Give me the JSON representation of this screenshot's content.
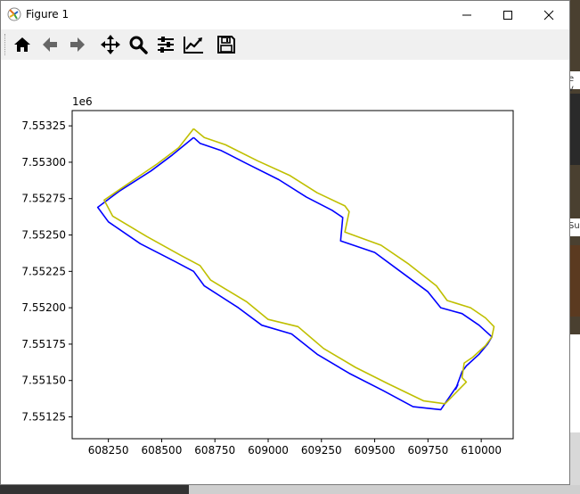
{
  "window": {
    "title": "Figure 1",
    "minimize_glyph": "—",
    "maximize_glyph": "☐",
    "close_glyph": "✕"
  },
  "toolbar": {
    "buttons": [
      {
        "icon": "home-icon"
      },
      {
        "icon": "back-arrow-icon"
      },
      {
        "icon": "forward-arrow-icon"
      },
      {
        "icon": "pan-move-icon"
      },
      {
        "icon": "zoom-magnifier-icon"
      },
      {
        "icon": "configure-subplots-icon"
      },
      {
        "icon": "edit-axis-icon"
      },
      {
        "icon": "save-floppy-icon"
      }
    ]
  },
  "background": {
    "right_text_1": "e v",
    "right_text_2": "Sup"
  },
  "chart_data": {
    "type": "line",
    "offset_label": "1e6",
    "xlim": [
      608080,
      610150
    ],
    "ylim": [
      7551100,
      7553355
    ],
    "xticks": [
      608250,
      608500,
      608750,
      609000,
      609250,
      609500,
      609750,
      610000
    ],
    "yticks": [
      7551250,
      7551500,
      7551750,
      7552000,
      7552250,
      7552500,
      7552750,
      7553000,
      7553250
    ],
    "ytick_labels": [
      "7.55125",
      "7.55150",
      "7.55175",
      "7.55200",
      "7.55225",
      "7.55250",
      "7.55275",
      "7.55300",
      "7.55325"
    ],
    "grid": false,
    "series": [
      {
        "color": "#0000ff",
        "points": [
          [
            608650,
            7553170
          ],
          [
            608680,
            7553130
          ],
          [
            608780,
            7553080
          ],
          [
            608900,
            7552990
          ],
          [
            609050,
            7552880
          ],
          [
            609180,
            7552760
          ],
          [
            609300,
            7552670
          ],
          [
            609350,
            7552620
          ],
          [
            609340,
            7552460
          ],
          [
            609500,
            7552380
          ],
          [
            609620,
            7552250
          ],
          [
            609750,
            7552110
          ],
          [
            609810,
            7552000
          ],
          [
            609910,
            7551960
          ],
          [
            609990,
            7551880
          ],
          [
            610050,
            7551800
          ],
          [
            610030,
            7551750
          ],
          [
            609990,
            7551680
          ],
          [
            609930,
            7551600
          ],
          [
            609910,
            7551560
          ],
          [
            609880,
            7551440
          ],
          [
            609890,
            7551470
          ],
          [
            609810,
            7551300
          ],
          [
            609680,
            7551320
          ],
          [
            609540,
            7551430
          ],
          [
            609380,
            7551550
          ],
          [
            609230,
            7551680
          ],
          [
            609110,
            7551820
          ],
          [
            608970,
            7551880
          ],
          [
            608860,
            7552000
          ],
          [
            608700,
            7552150
          ],
          [
            608650,
            7552250
          ],
          [
            608560,
            7552320
          ],
          [
            608400,
            7552440
          ],
          [
            608250,
            7552590
          ],
          [
            608200,
            7552690
          ],
          [
            608300,
            7552800
          ],
          [
            608450,
            7552940
          ],
          [
            608550,
            7553050
          ],
          [
            608650,
            7553170
          ]
        ]
      },
      {
        "color": "#bfbf00",
        "points": [
          [
            608650,
            7553230
          ],
          [
            608700,
            7553170
          ],
          [
            608800,
            7553120
          ],
          [
            608950,
            7553010
          ],
          [
            609100,
            7552910
          ],
          [
            609230,
            7552790
          ],
          [
            609360,
            7552700
          ],
          [
            609380,
            7552660
          ],
          [
            609360,
            7552520
          ],
          [
            609530,
            7552430
          ],
          [
            609660,
            7552300
          ],
          [
            609790,
            7552150
          ],
          [
            609840,
            7552050
          ],
          [
            609950,
            7552000
          ],
          [
            610020,
            7551930
          ],
          [
            610060,
            7551870
          ],
          [
            610050,
            7551800
          ],
          [
            610020,
            7551740
          ],
          [
            609960,
            7551660
          ],
          [
            609920,
            7551620
          ],
          [
            609910,
            7551520
          ],
          [
            609930,
            7551490
          ],
          [
            609830,
            7551340
          ],
          [
            609730,
            7551360
          ],
          [
            609560,
            7551480
          ],
          [
            609410,
            7551590
          ],
          [
            609260,
            7551720
          ],
          [
            609140,
            7551870
          ],
          [
            609000,
            7551920
          ],
          [
            608900,
            7552040
          ],
          [
            608730,
            7552190
          ],
          [
            608680,
            7552290
          ],
          [
            608590,
            7552360
          ],
          [
            608430,
            7552490
          ],
          [
            608270,
            7552630
          ],
          [
            608230,
            7552740
          ],
          [
            608340,
            7552850
          ],
          [
            608480,
            7552990
          ],
          [
            608580,
            7553100
          ],
          [
            608650,
            7553230
          ]
        ]
      }
    ]
  }
}
